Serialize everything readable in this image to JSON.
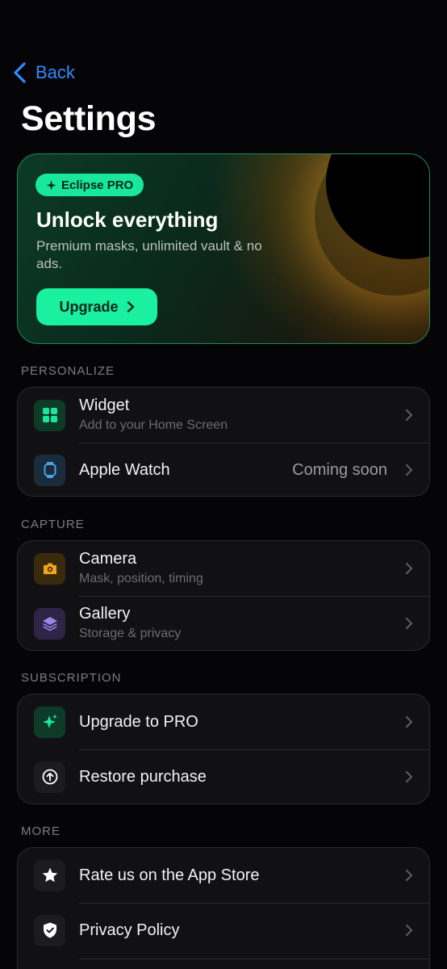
{
  "nav": {
    "back_label": "Back"
  },
  "page_title": "Settings",
  "promo": {
    "badge": "Eclipse PRO",
    "title": "Unlock everything",
    "subtitle": "Premium masks, unlimited vault & no ads.",
    "button": "Upgrade"
  },
  "sections": {
    "personalize": {
      "header": "PERSONALIZE",
      "items": [
        {
          "label": "Widget",
          "sub": "Add to your Home Screen",
          "icon": "widget-grid-icon"
        },
        {
          "label": "Apple Watch",
          "value": "Coming soon",
          "icon": "watch-icon"
        }
      ]
    },
    "capture": {
      "header": "CAPTURE",
      "items": [
        {
          "label": "Camera",
          "sub": "Mask, position, timing",
          "icon": "camera-icon"
        },
        {
          "label": "Gallery",
          "sub": "Storage & privacy",
          "icon": "layers-icon"
        }
      ]
    },
    "subscription": {
      "header": "SUBSCRIPTION",
      "items": [
        {
          "label": "Upgrade to PRO",
          "icon": "sparkle-icon"
        },
        {
          "label": "Restore purchase",
          "icon": "restore-arrow-icon"
        }
      ]
    },
    "more": {
      "header": "MORE",
      "items": [
        {
          "label": "Rate us on the App Store",
          "icon": "star-icon"
        },
        {
          "label": "Privacy Policy",
          "icon": "shield-check-icon"
        }
      ]
    }
  },
  "colors": {
    "accent_green": "#19f0a0",
    "link_blue": "#2f8cff",
    "background": "#050507",
    "card": "#111114"
  }
}
